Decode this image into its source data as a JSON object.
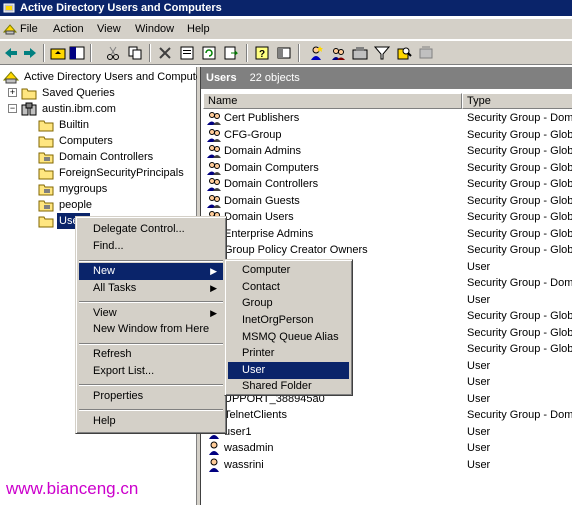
{
  "window": {
    "title": "Active Directory Users and Computers"
  },
  "menubar": {
    "items": [
      "File",
      "Action",
      "View",
      "Window",
      "Help"
    ]
  },
  "toolbar": {
    "icons": [
      "back-arrow-icon",
      "forward-arrow-icon",
      "up-folder-icon",
      "show-tree-icon",
      "cut-icon",
      "copy-icon",
      "delete-icon",
      "properties-icon",
      "refresh-icon",
      "export-icon",
      "help-icon",
      "console-icon",
      "new-user-icon",
      "new-group-icon",
      "new-ou-icon",
      "filter-icon",
      "find-icon",
      "add-to-group-icon"
    ]
  },
  "tree": {
    "root": "Active Directory Users and Computers",
    "saved_queries": "Saved Queries",
    "domain": "austin.ibm.com",
    "children": [
      "Builtin",
      "Computers",
      "Domain Controllers",
      "ForeignSecurityPrincipals",
      "mygroups",
      "people",
      "Users"
    ]
  },
  "details": {
    "title": "Users",
    "count": "22 objects",
    "columns": [
      "Name",
      "Type"
    ],
    "rows": [
      {
        "name": "Cert Publishers",
        "type": "Security Group - Doma"
      },
      {
        "name": "CFG-Group",
        "type": "Security Group - Globa"
      },
      {
        "name": "Domain Admins",
        "type": "Security Group - Globa"
      },
      {
        "name": "Domain Computers",
        "type": "Security Group - Globa"
      },
      {
        "name": "Domain Controllers",
        "type": "Security Group - Globa"
      },
      {
        "name": "Domain Guests",
        "type": "Security Group - Globa"
      },
      {
        "name": "Domain Users",
        "type": "Security Group - Globa"
      },
      {
        "name": "Enterprise Admins",
        "type": "Security Group - Globa"
      },
      {
        "name": "Group Policy Creator Owners",
        "type": "Security Group - Globa"
      },
      {
        "name": "",
        "type": "User"
      },
      {
        "name": "",
        "type": "Security Group - Doma"
      },
      {
        "name": "",
        "type": "User"
      },
      {
        "name": "",
        "type": "Security Group - Globa"
      },
      {
        "name": "",
        "type": "Security Group - Globa"
      },
      {
        "name": "",
        "type": "Security Group - Globa"
      },
      {
        "name": "",
        "type": "User"
      },
      {
        "name": "",
        "type": "User"
      },
      {
        "name": "UPPORT_388945a0",
        "type": "User"
      },
      {
        "name": "TelnetClients",
        "type": "Security Group - Doma"
      },
      {
        "name": "user1",
        "type": "User"
      },
      {
        "name": "wasadmin",
        "type": "User"
      },
      {
        "name": "wassrini",
        "type": "User"
      }
    ]
  },
  "context_menu": {
    "items": [
      "Delegate Control...",
      "Find...",
      "New",
      "All Tasks",
      "View",
      "New Window from Here",
      "Refresh",
      "Export List...",
      "Properties",
      "Help"
    ]
  },
  "submenu": {
    "items": [
      "Computer",
      "Contact",
      "Group",
      "InetOrgPerson",
      "MSMQ Queue Alias",
      "Printer",
      "User",
      "Shared Folder"
    ]
  },
  "watermark": "www.bianceng.cn",
  "colors": {
    "selection": "#0a246a",
    "titlebar": "#0a246a",
    "face": "#d4d0c8",
    "watermark": "#cc00cc"
  }
}
